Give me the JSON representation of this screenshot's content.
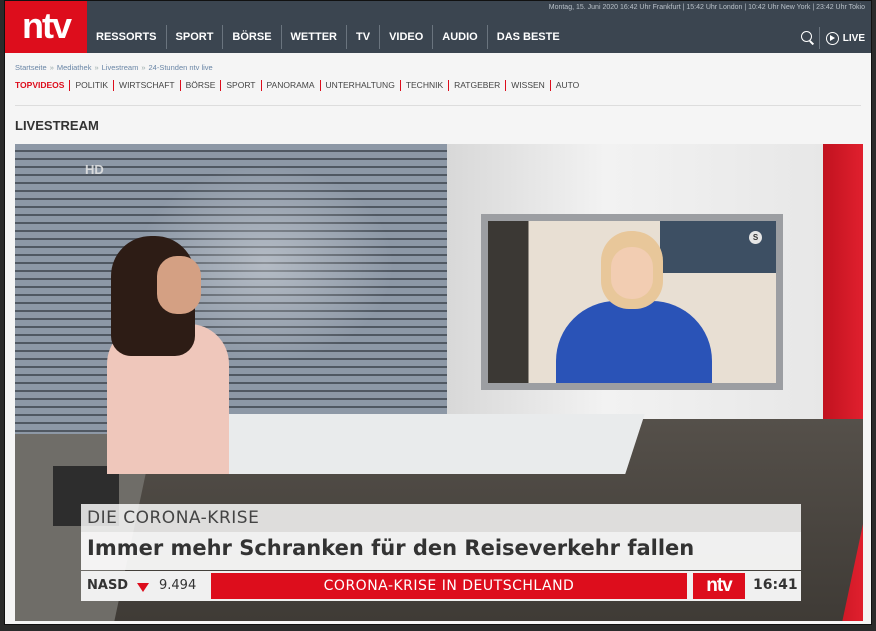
{
  "header": {
    "logo": "ntv",
    "times": "Montag, 15. Juni 2020 16:42 Uhr Frankfurt | 15:42 Uhr London | 10:42 Uhr New York | 23:42 Uhr Tokio",
    "nav": [
      "RESSORTS",
      "SPORT",
      "BÖRSE",
      "WETTER",
      "TV",
      "VIDEO",
      "AUDIO",
      "DAS BESTE"
    ],
    "live_label": "LIVE"
  },
  "breadcrumb": [
    "Startseite",
    "Mediathek",
    "Livestream",
    "24-Stunden ntv live"
  ],
  "subnav": [
    "TOPVIDEOS",
    "POLITIK",
    "WIRTSCHAFT",
    "BÖRSE",
    "SPORT",
    "PANORAMA",
    "UNTERHALTUNG",
    "TECHNIK",
    "RATGEBER",
    "WISSEN",
    "AUTO"
  ],
  "section_title": "LIVESTREAM",
  "video": {
    "hd_badge": "HD",
    "screen_logo": "S",
    "topic": "DIE CORONA-KRISE",
    "headline": "Immer mehr Schranken für den Reiseverkehr fallen",
    "ticker_index": "NASD",
    "ticker_value": "9.494",
    "ticker_text": "CORONA-KRISE IN DEUTSCHLAND",
    "ticker_logo": "ntv",
    "time": "16:41"
  },
  "colors": {
    "brand_red": "#dd0d1c",
    "header_bg": "#3b4550"
  }
}
